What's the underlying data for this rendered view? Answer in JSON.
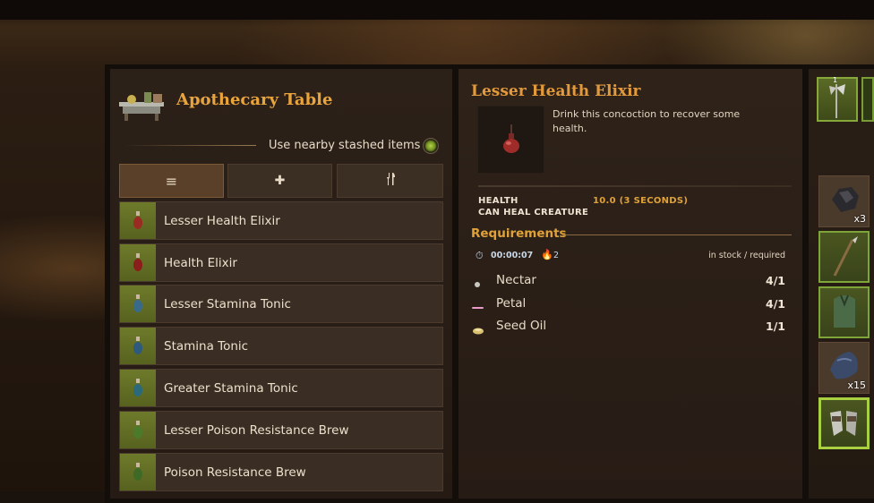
{
  "station": {
    "title": "Apothecary Table",
    "stash_label": "Use nearby stashed items",
    "stash_enabled": true
  },
  "tabs": [
    {
      "icon": "list-icon",
      "glyph": "≡",
      "active": true
    },
    {
      "icon": "plus-icon",
      "glyph": "✚",
      "active": false
    },
    {
      "icon": "utensils-icon",
      "glyph": "🍴",
      "active": false
    }
  ],
  "recipes": [
    {
      "label": "Lesser Health Elixir",
      "potion_color": "#9a2b22"
    },
    {
      "label": "Health Elixir",
      "potion_color": "#8a1e1a"
    },
    {
      "label": "Lesser Stamina Tonic",
      "potion_color": "#3a6a8a"
    },
    {
      "label": "Stamina Tonic",
      "potion_color": "#2e5a7e"
    },
    {
      "label": "Greater Stamina Tonic",
      "potion_color": "#2a6a7a"
    },
    {
      "label": "Lesser Poison Resistance Brew",
      "potion_color": "#4a7a2a"
    },
    {
      "label": "Poison Resistance Brew",
      "potion_color": "#3e6a26"
    }
  ],
  "detail": {
    "title": "Lesser Health Elixir",
    "description": "Drink this concoction to recover some health.",
    "stats": [
      {
        "key": "HEALTH",
        "value": "10.0 (3 SECONDS)"
      },
      {
        "key": "CAN HEAL CREATURE",
        "value": ""
      }
    ],
    "requirements_title": "Requirements",
    "craft_time": "00:00:07",
    "heat_level": "2",
    "stock_label": "in stock / required",
    "ingredients": [
      {
        "name": "Nectar",
        "qty": "4/1",
        "icon": "nectar-icon"
      },
      {
        "name": "Petal",
        "qty": "4/1",
        "icon": "petal-icon"
      },
      {
        "name": "Seed Oil",
        "qty": "1/1",
        "icon": "seed-oil-icon"
      }
    ]
  },
  "equipment": {
    "slot_number": "1"
  },
  "inventory": [
    {
      "icon": "stone-ore-icon",
      "count": "x3"
    },
    {
      "icon": "spear-icon",
      "count": ""
    },
    {
      "icon": "vest-icon",
      "count": ""
    },
    {
      "icon": "fabric-icon",
      "count": "x15"
    },
    {
      "icon": "gloves-icon",
      "count": ""
    }
  ],
  "colors": {
    "accent": "#e39a3c",
    "panel": "#2c2119",
    "slot_green": "#6e7a2a"
  }
}
